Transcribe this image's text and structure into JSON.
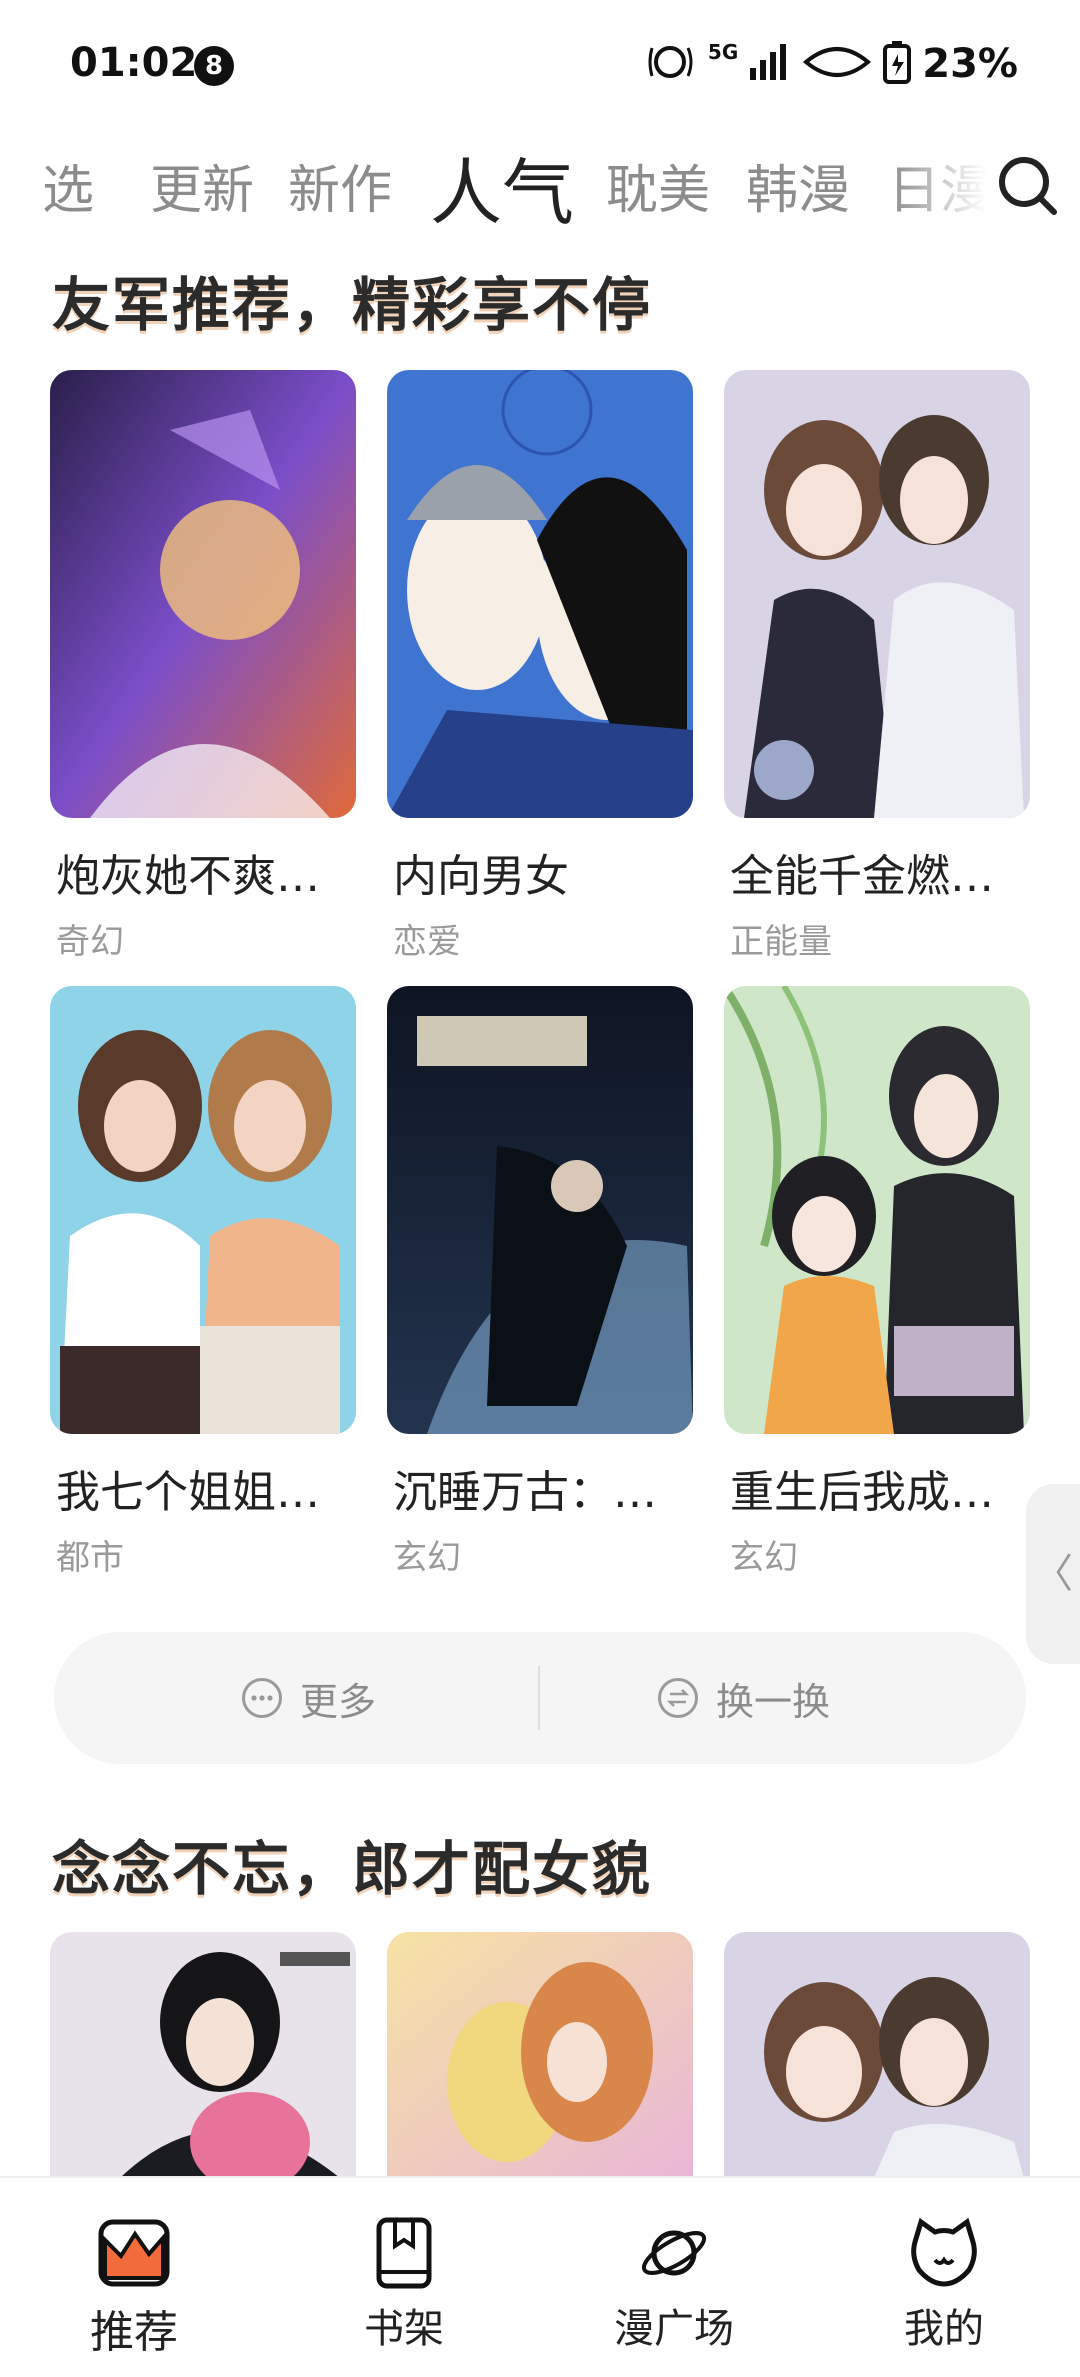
{
  "status": {
    "time": "01:02",
    "notification_count": "8",
    "network": "5G",
    "battery": "23%"
  },
  "tabs": [
    {
      "label": "选"
    },
    {
      "label": "更新"
    },
    {
      "label": "新作"
    },
    {
      "label": "人气"
    },
    {
      "label": "耽美"
    },
    {
      "label": "韩漫"
    },
    {
      "label": "日漫"
    }
  ],
  "sections": [
    {
      "title": "友军推荐，精彩享不停",
      "items": [
        {
          "title": "炮灰她不爽…",
          "genre": "奇幻"
        },
        {
          "title": "内向男女",
          "genre": "恋爱"
        },
        {
          "title": "全能千金燃…",
          "genre": "正能量"
        },
        {
          "title": "我七个姐姐…",
          "genre": "都市"
        },
        {
          "title": "沉睡万古：…",
          "genre": "玄幻"
        },
        {
          "title": "重生后我成…",
          "genre": "玄幻"
        }
      ]
    },
    {
      "title": "念念不忘，郎才配女貌",
      "items": []
    }
  ],
  "actions": {
    "more_label": "更多",
    "refresh_label": "换一换"
  },
  "side_handle": "〈",
  "bottom_nav": [
    {
      "label": "推荐"
    },
    {
      "label": "书架"
    },
    {
      "label": "漫广场"
    },
    {
      "label": "我的"
    }
  ],
  "colors": {
    "accent": "#f26b3a",
    "title_shadow": "#f1d2b8",
    "inactive_tab": "#8c8c8c",
    "genre_text": "#9a9a9a"
  }
}
